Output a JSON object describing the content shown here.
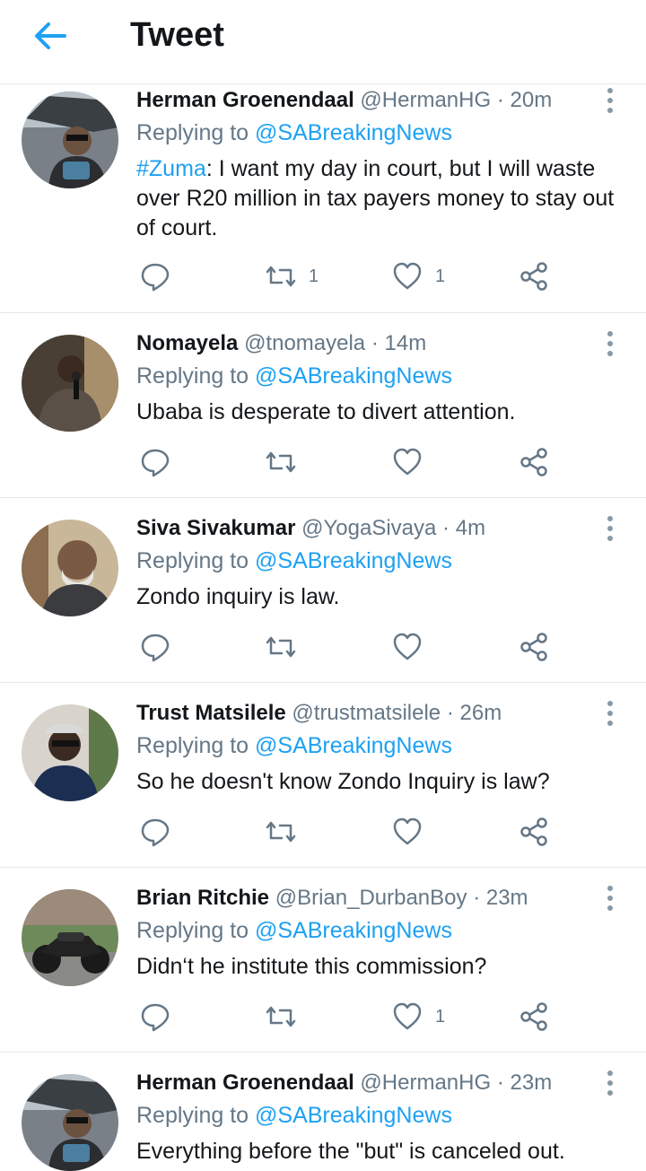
{
  "header": {
    "title": "Tweet",
    "back_icon": "arrow-left-icon",
    "accent": "#1da1f2"
  },
  "colors": {
    "link": "#1da1f2",
    "secondary": "#657786",
    "text": "#14171a",
    "divider": "#e1e8ed"
  },
  "tweets": [
    {
      "name": "Herman Groenendaal",
      "handle": "@HermanHG",
      "dot": "·",
      "time": "20m",
      "replying_prefix": "Replying to ",
      "replying_to": "@SABreakingNews",
      "hashtag": "#Zuma",
      "text_lines": [
        ": I want my day in court, but I will waste",
        "over R20 million in tax payers money to stay out",
        "of court."
      ],
      "retweets": "1",
      "likes": "1"
    },
    {
      "name": "Nomayela",
      "handle": "@tnomayela",
      "dot": "·",
      "time": "14m",
      "replying_prefix": "Replying to ",
      "replying_to": "@SABreakingNews",
      "text": "Ubaba is desperate to divert attention.",
      "retweets": "",
      "likes": ""
    },
    {
      "name": "Siva Sivakumar",
      "handle": "@YogaSivaya",
      "dot": "·",
      "time": "4m",
      "replying_prefix": "Replying to ",
      "replying_to": "@SABreakingNews",
      "text": "Zondo inquiry is law.",
      "retweets": "",
      "likes": ""
    },
    {
      "name": "Trust Matsilele",
      "handle": "@trustmatsilele",
      "dot": "·",
      "time": "26m",
      "replying_prefix": "Replying to ",
      "replying_to": "@SABreakingNews",
      "text": "So he doesn't know Zondo Inquiry is law?",
      "retweets": "",
      "likes": ""
    },
    {
      "name": "Brian Ritchie",
      "handle": "@Brian_DurbanBoy",
      "dot": "·",
      "time": "23m",
      "replying_prefix": "Replying to ",
      "replying_to": "@SABreakingNews",
      "text": "Didn‘t he institute this commission?",
      "retweets": "",
      "likes": "1"
    },
    {
      "name": "Herman Groenendaal",
      "handle": "@HermanHG",
      "dot": "·",
      "time": "23m",
      "replying_prefix": "Replying to ",
      "replying_to": "@SABreakingNews",
      "text": "Everything before the \"but\" is canceled out.",
      "retweets": "",
      "likes": ""
    }
  ]
}
